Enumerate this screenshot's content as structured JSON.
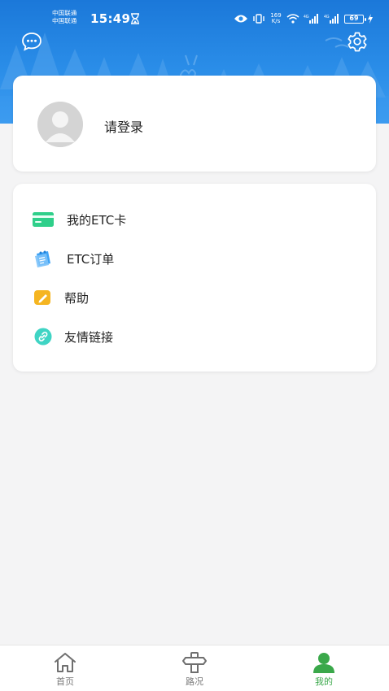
{
  "status_bar": {
    "carrier_1": "中国联通",
    "carrier_2": "中国联通",
    "time": "15:49",
    "net_speed_value": "169",
    "net_speed_unit": "K/s",
    "signal_1_label": "4G",
    "signal_2_label": "4G",
    "battery": "69"
  },
  "header": {
    "left_icon": "message-icon",
    "right_icon": "settings-icon",
    "background_color": "#2a8de8"
  },
  "profile": {
    "login_label": "请登录",
    "avatar_icon": "default-avatar-icon"
  },
  "menu": {
    "items": [
      {
        "label": "我的ETC卡",
        "icon": "card-icon",
        "color": "#2fcf8a"
      },
      {
        "label": "ETC订单",
        "icon": "order-icon",
        "color": "#3fa3f5"
      },
      {
        "label": "帮助",
        "icon": "help-icon",
        "color": "#f5b521"
      },
      {
        "label": "友情链接",
        "icon": "link-icon",
        "color": "#3fd4c4"
      }
    ]
  },
  "tabbar": {
    "active_color": "#3aa84a",
    "tabs": [
      {
        "label": "首页",
        "icon": "home-icon",
        "active": false
      },
      {
        "label": "路况",
        "icon": "road-sign-icon",
        "active": false
      },
      {
        "label": "我的",
        "icon": "user-icon",
        "active": true
      }
    ]
  }
}
